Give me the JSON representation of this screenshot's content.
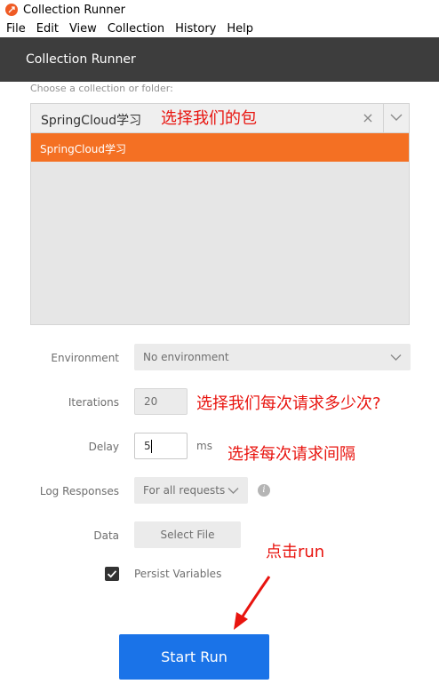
{
  "window": {
    "title": "Collection Runner"
  },
  "menu": [
    "File",
    "Edit",
    "View",
    "Collection",
    "History",
    "Help"
  ],
  "header": {
    "title": "Collection Runner"
  },
  "collection": {
    "label": "Choose a collection or folder:",
    "selected": "SpringCloud学习",
    "clear_glyph": "×",
    "options": [
      "SpringCloud学习"
    ]
  },
  "form": {
    "environment": {
      "label": "Environment",
      "value": "No environment"
    },
    "iterations": {
      "label": "Iterations",
      "value": "20"
    },
    "delay": {
      "label": "Delay",
      "value": "5",
      "unit": "ms"
    },
    "log_responses": {
      "label": "Log Responses",
      "value": "For all requests"
    },
    "data": {
      "label": "Data",
      "button": "Select File"
    },
    "persist": {
      "label": "Persist Variables",
      "checked": true
    }
  },
  "start_run": {
    "label": "Start Run"
  },
  "annotations": {
    "choose_package": "选择我们的包",
    "choose_count": "选择我们每次请求多少次?",
    "choose_interval": "选择每次请求间隔",
    "click_run": "点击run"
  },
  "colors": {
    "accent_orange": "#f47023",
    "header_dark": "#3d3d3d",
    "run_button_blue": "#1a73e8",
    "annotation_red": "#e8140f"
  },
  "icons": {
    "app": "postman-icon",
    "clear": "close-icon",
    "dropdown": "chevron-down-icon",
    "info": "info-icon",
    "check": "checkmark-icon",
    "arrow": "red-arrow"
  }
}
